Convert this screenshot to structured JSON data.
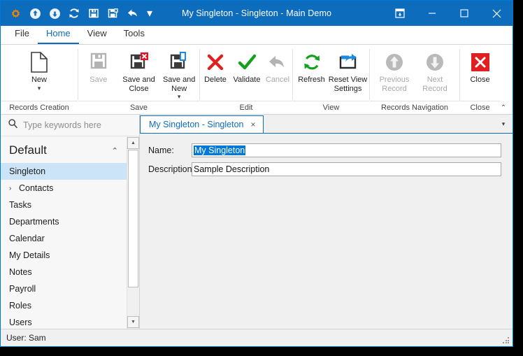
{
  "window": {
    "title": "My Singleton - Singleton - Main Demo",
    "accent": "#0e6cbd",
    "selection_color": "#0078d7"
  },
  "quick_access": {
    "items": [
      {
        "name": "app-gear-icon",
        "label": "App"
      },
      {
        "name": "upload-icon",
        "label": "Upload"
      },
      {
        "name": "download-icon",
        "label": "Download"
      },
      {
        "name": "refresh-icon",
        "label": "Refresh"
      },
      {
        "name": "save-icon",
        "label": "Save"
      },
      {
        "name": "save-and-close-icon",
        "label": "Save and Close"
      },
      {
        "name": "undo-icon",
        "label": "Undo"
      }
    ],
    "overflow_label": "▾"
  },
  "window_controls": {
    "ribbon_options": "Ribbon Display Options",
    "minimize": "Minimize",
    "maximize": "Maximize",
    "close": "Close"
  },
  "ribbon_tabs": [
    {
      "label": "File",
      "active": false
    },
    {
      "label": "Home",
      "active": true
    },
    {
      "label": "View",
      "active": false
    },
    {
      "label": "Tools",
      "active": false
    }
  ],
  "ribbon": {
    "collapse_label": "⌃",
    "groups": [
      {
        "label": "Records Creation",
        "buttons": [
          {
            "label": "New",
            "icon": "new-document-icon",
            "disabled": false,
            "dropdown": true
          }
        ]
      },
      {
        "label": "Save",
        "buttons": [
          {
            "label": "Save",
            "icon": "floppy-disk-icon",
            "disabled": true,
            "dropdown": false
          },
          {
            "label": "Save and Close",
            "icon": "floppy-disk-close-icon",
            "disabled": false,
            "dropdown": false
          },
          {
            "label": "Save and New",
            "icon": "floppy-disk-new-icon",
            "disabled": false,
            "dropdown": true
          }
        ]
      },
      {
        "label": "Edit",
        "buttons": [
          {
            "label": "Delete",
            "icon": "red-cross-icon",
            "disabled": false,
            "dropdown": false
          },
          {
            "label": "Validate",
            "icon": "green-check-icon",
            "disabled": false,
            "dropdown": false
          },
          {
            "label": "Cancel",
            "icon": "undo-arrow-icon",
            "disabled": true,
            "dropdown": false
          }
        ]
      },
      {
        "label": "View",
        "buttons": [
          {
            "label": "Refresh",
            "icon": "refresh-circular-icon",
            "disabled": false,
            "dropdown": false
          },
          {
            "label": "Reset View Settings",
            "icon": "reset-view-icon",
            "disabled": false,
            "dropdown": false
          }
        ]
      },
      {
        "label": "Records Navigation",
        "buttons": [
          {
            "label": "Previous Record",
            "icon": "up-arrow-circle-icon",
            "disabled": true,
            "dropdown": false
          },
          {
            "label": "Next Record",
            "icon": "down-arrow-circle-icon",
            "disabled": true,
            "dropdown": false
          }
        ]
      },
      {
        "label": "Close",
        "buttons": [
          {
            "label": "Close",
            "icon": "red-square-close-icon",
            "disabled": false,
            "dropdown": false
          }
        ]
      }
    ]
  },
  "sidebar": {
    "search": {
      "placeholder": "Type keywords here",
      "value": "",
      "icon": "search-icon"
    },
    "group": {
      "title": "Default",
      "chevron": "⌃"
    },
    "items": [
      {
        "label": "Singleton",
        "selected": true,
        "expandable": false
      },
      {
        "label": "Contacts",
        "selected": false,
        "expandable": true
      },
      {
        "label": "Tasks",
        "selected": false,
        "expandable": false
      },
      {
        "label": "Departments",
        "selected": false,
        "expandable": false
      },
      {
        "label": "Calendar",
        "selected": false,
        "expandable": false
      },
      {
        "label": "My Details",
        "selected": false,
        "expandable": false
      },
      {
        "label": "Notes",
        "selected": false,
        "expandable": false
      },
      {
        "label": "Payroll",
        "selected": false,
        "expandable": false
      },
      {
        "label": "Roles",
        "selected": false,
        "expandable": false
      },
      {
        "label": "Users",
        "selected": false,
        "expandable": false
      }
    ],
    "scroll": {
      "up": "▲",
      "down": "▼"
    }
  },
  "document": {
    "tabs": [
      {
        "label": "My Singleton - Singleton",
        "close": "×",
        "active": true
      }
    ],
    "tab_overflow": "▾",
    "form": {
      "fields": [
        {
          "label": "Name:",
          "value": "My Singleton",
          "selected": true
        },
        {
          "label": "Description:",
          "value": "Sample Description",
          "selected": false
        }
      ]
    }
  },
  "statusbar": {
    "text": "User: Sam"
  }
}
